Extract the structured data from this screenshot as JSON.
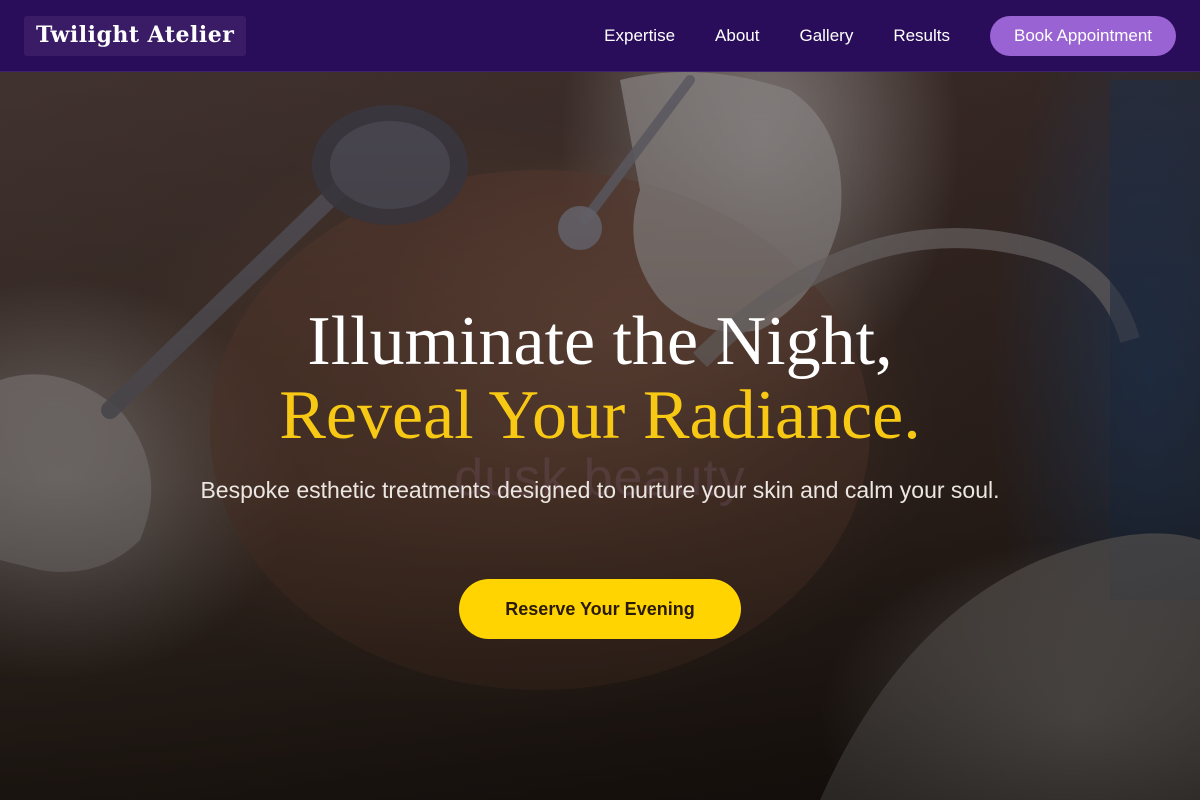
{
  "brand": {
    "name": "Twilight Atelier"
  },
  "nav": {
    "links": [
      {
        "label": "Expertise"
      },
      {
        "label": "About"
      },
      {
        "label": "Gallery"
      },
      {
        "label": "Results"
      }
    ],
    "cta_label": "Book Appointment"
  },
  "hero": {
    "headline_line1": "Illuminate the Night,",
    "headline_line2": "Reveal Your Radiance.",
    "watermark": "dusk beauty",
    "subtitle": "Bespoke esthetic treatments designed to nurture your skin and calm your soul.",
    "cta_label": "Reserve Your Evening",
    "background_image": "facial-treatment-photo"
  },
  "colors": {
    "nav_background": "#2a0d5a",
    "brand_box": "#3a1c66",
    "book_button": "#9a63d3",
    "accent_gold": "#f7c814",
    "cta_button": "#ffd400",
    "cta_text": "#2b1a06"
  }
}
